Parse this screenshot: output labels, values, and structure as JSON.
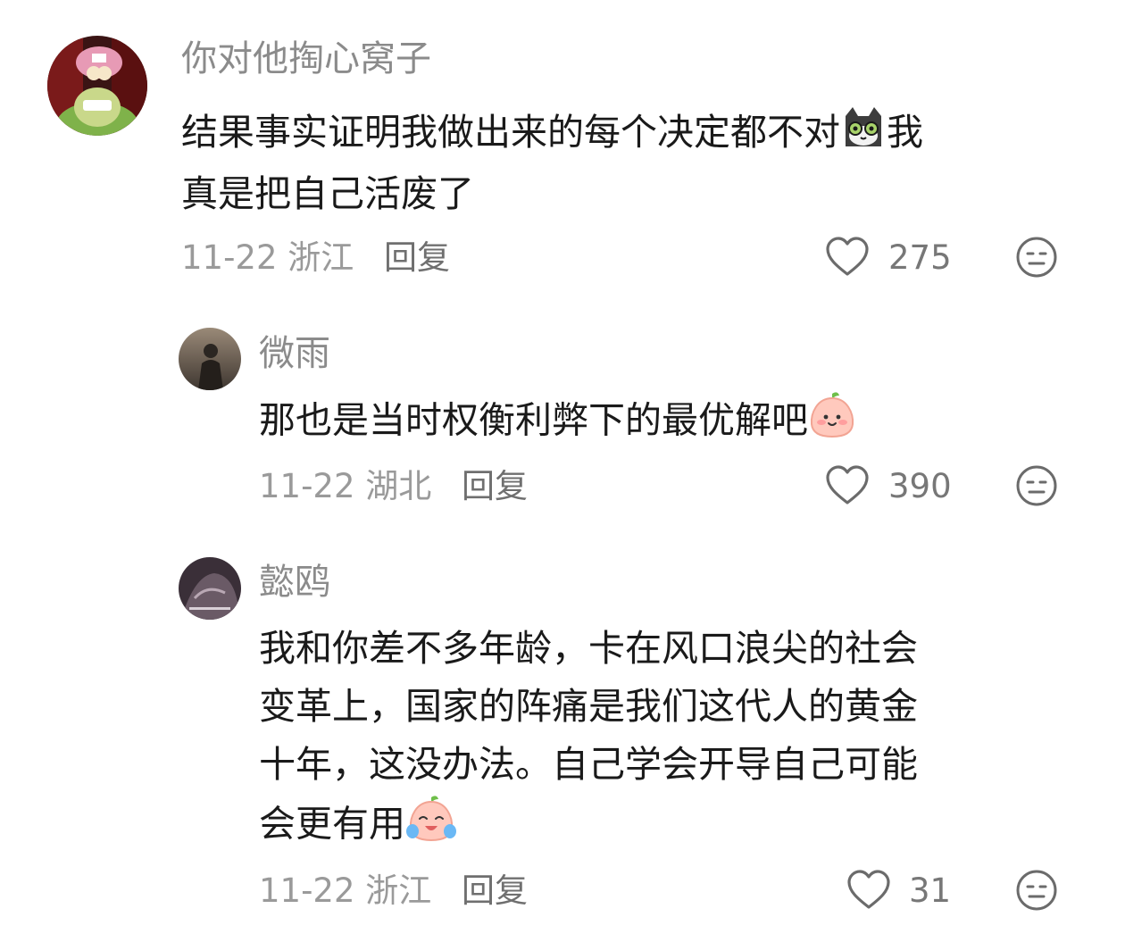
{
  "comments": [
    {
      "username": "你对他掏心窝子",
      "text_a": "结果事实证明我做出来的每个决定都不对",
      "text_b": "我",
      "text_line2": "真是把自己活废了",
      "date": "11-22",
      "location": "浙江",
      "reply_label": "回复",
      "likes": "275",
      "inline_emoji": "cat-emoji"
    },
    {
      "username": "微雨",
      "text": "那也是当时权衡利弊下的最优解吧",
      "date": "11-22",
      "location": "湖北",
      "reply_label": "回复",
      "likes": "390",
      "inline_emoji": "smiling-peach-emoji"
    },
    {
      "username": "懿鸥",
      "line1": "我和你差不多年龄，卡在风口浪尖的社会",
      "line2": "变革上，国家的阵痛是我们这代人的黄金",
      "line3": "十年，这没办法。自己学会开导自己可能",
      "line4": "会更有用",
      "date": "11-22",
      "location": "浙江",
      "reply_label": "回复",
      "likes": "31",
      "inline_emoji": "crying-peach-emoji"
    }
  ]
}
